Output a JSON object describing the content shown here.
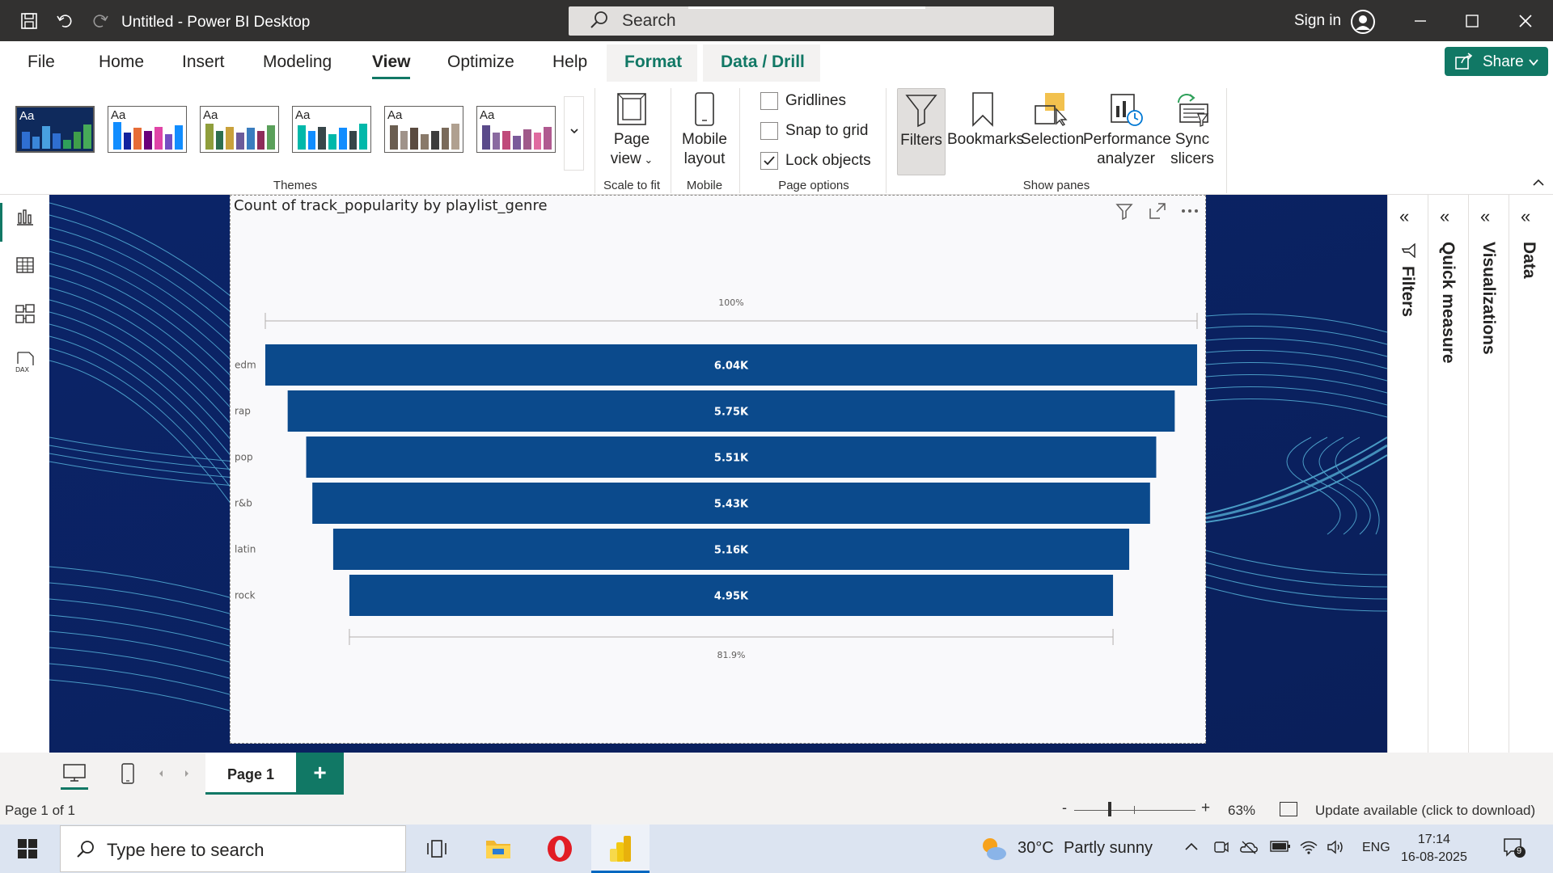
{
  "titlebar": {
    "title": "Untitled - Power BI Desktop",
    "search_placeholder": "Search",
    "signin": "Sign in"
  },
  "menu": {
    "tabs": [
      "File",
      "Home",
      "Insert",
      "Modeling",
      "View",
      "Optimize",
      "Help",
      "Format",
      "Data / Drill"
    ],
    "active": "View",
    "share": "Share"
  },
  "ribbon": {
    "themes_label": "Themes",
    "themes": [
      {
        "aa": "Aa",
        "colors": [
          "#2f6fd1",
          "#2f6fd1",
          "#3a86d8",
          "#48a0e0",
          "#2fa05a",
          "#3f9e4a",
          "#46aa58"
        ]
      },
      {
        "aa": "Aa",
        "colors": [
          "#118dff",
          "#12239e",
          "#e66c37",
          "#6b007b",
          "#e044a7",
          "#744ec2",
          "#d9b300"
        ]
      },
      {
        "aa": "Aa",
        "colors": [
          "#8f9e3c",
          "#2d6e4e",
          "#c9a13b",
          "#6c5b9a",
          "#3a7dbf",
          "#8e2c5a",
          "#5aa05a"
        ]
      },
      {
        "aa": "Aa",
        "colors": [
          "#01b8aa",
          "#374649",
          "#fd625e",
          "#f2c80f",
          "#5f6b6d",
          "#8ad4eb",
          "#fe9666"
        ]
      },
      {
        "aa": "Aa",
        "colors": [
          "#6b5e51",
          "#a0938a",
          "#5a4a3f",
          "#8a7a6a",
          "#3c3c3c",
          "#7a6a5a",
          "#b0a090"
        ]
      },
      {
        "aa": "Aa",
        "colors": [
          "#5a4a8a",
          "#8a6aa0",
          "#c04a7a",
          "#7a5a9a",
          "#a05a8a",
          "#e06aa0",
          "#b05a90"
        ]
      }
    ],
    "page_view": "Page\nview",
    "page_view_line1": "Page",
    "page_view_line2": "view",
    "scale_label": "Scale to fit",
    "mobile_line1": "Mobile",
    "mobile_line2": "layout",
    "mobile_label": "Mobile",
    "gridlines": "Gridlines",
    "snap": "Snap to grid",
    "lock": "Lock objects",
    "page_options_label": "Page options",
    "filters": "Filters",
    "bookmarks": "Bookmarks",
    "selection": "Selection",
    "perf_line1": "Performance",
    "perf_line2": "analyzer",
    "sync_line1": "Sync",
    "sync_line2": "slicers",
    "show_panes_label": "Show panes"
  },
  "visual": {
    "title": "Count of track_popularity by playlist_genre",
    "top_pct": "100%",
    "bottom_pct": "81.9%"
  },
  "chart_data": {
    "type": "bar",
    "subtype": "funnel",
    "title": "Count of track_popularity by playlist_genre",
    "categories": [
      "edm",
      "rap",
      "pop",
      "r&b",
      "latin",
      "rock"
    ],
    "values": [
      6040,
      5750,
      5510,
      5430,
      5160,
      4950
    ],
    "labels": [
      "6.04K",
      "5.75K",
      "5.51K",
      "5.43K",
      "5.16K",
      "4.95K"
    ],
    "top_label": "100%",
    "bottom_label": "81.9%",
    "color": "#0b4a8c"
  },
  "panes": [
    "Filters",
    "Quick measure",
    "Visualizations",
    "Data"
  ],
  "pagebar": {
    "tab": "Page 1",
    "add": "+"
  },
  "status": {
    "page": "Page 1 of 1",
    "zoom_minus": "-",
    "zoom_plus": "+",
    "zoom": "63%",
    "zoom_value": 0.63,
    "update": "Update available (click to download)"
  },
  "taskbar": {
    "search": "Type here to search",
    "temp": "30°C",
    "weather": "Partly sunny",
    "lang": "ENG",
    "time": "17:14",
    "date": "16-08-2025",
    "notifications": "9"
  }
}
